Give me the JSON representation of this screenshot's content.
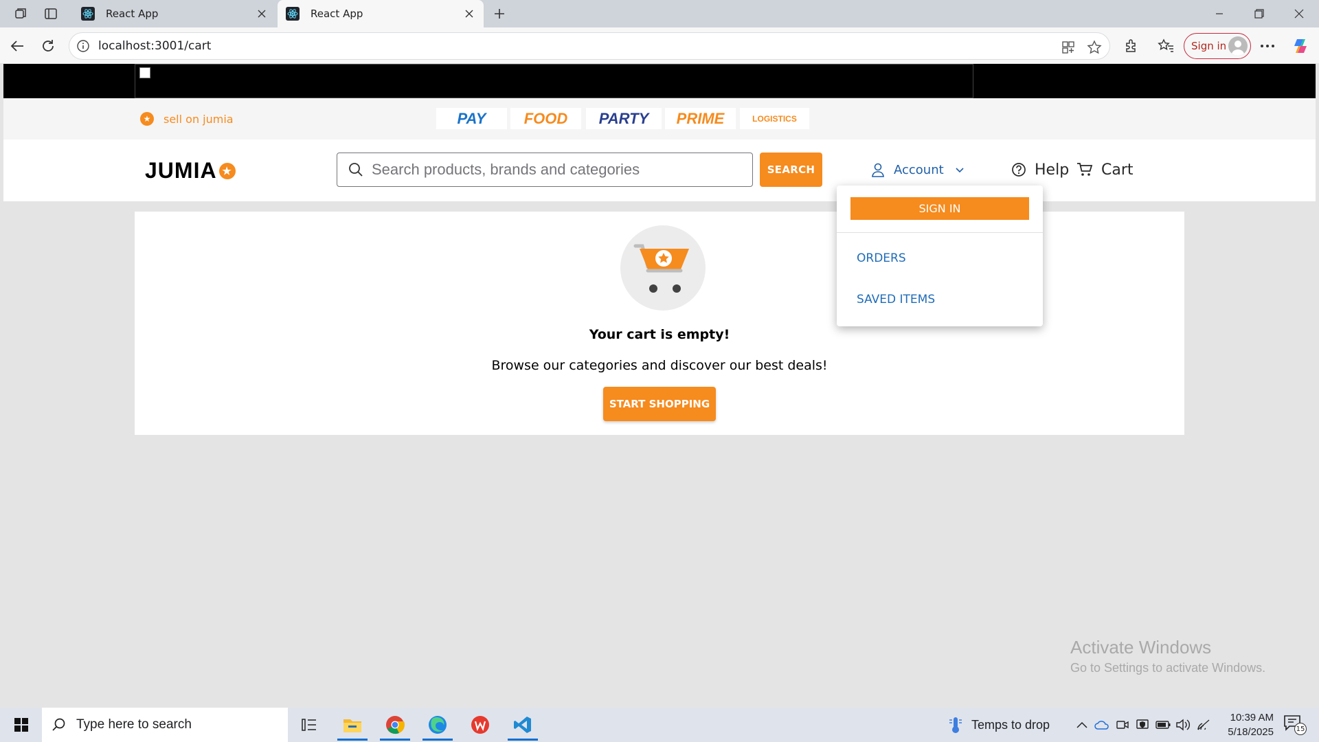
{
  "browser": {
    "tabs": [
      {
        "title": "React App",
        "active": false
      },
      {
        "title": "React App",
        "active": true
      }
    ],
    "url": "localhost:3001/cart",
    "profile_label": "Sign in"
  },
  "page": {
    "sell_label": "sell on jumia",
    "partners": [
      {
        "label": "PAY",
        "color": "#1a73c9"
      },
      {
        "label": "FOOD",
        "color": "#f68b1e"
      },
      {
        "label": "PARTY",
        "color": "#2a3f8f"
      },
      {
        "label": "PRIME",
        "color": "#f68b1e"
      },
      {
        "label": "LOGISTICS",
        "color": "#f68b1e"
      }
    ],
    "logo_text": "JUMIA",
    "search": {
      "placeholder": "Search products, brands and categories",
      "button": "SEARCH"
    },
    "account_label": "Account",
    "help_label": "Help",
    "cart_label": "Cart",
    "empty_cart": {
      "title": "Your cart is empty!",
      "subtitle": "Browse our categories and discover our best deals!",
      "button": "START SHOPPING"
    },
    "account_menu": {
      "sign_in": "SIGN IN",
      "items": [
        "ORDERS",
        "SAVED ITEMS"
      ]
    },
    "activate_windows": {
      "title": "Activate Windows",
      "subtitle": "Go to Settings to activate Windows."
    },
    "accent_color": "#f68b1e"
  },
  "taskbar": {
    "search_placeholder": "Type here to search",
    "weather": "Temps to drop",
    "time": "10:39 AM",
    "date": "5/18/2025",
    "notification_count": "15"
  }
}
